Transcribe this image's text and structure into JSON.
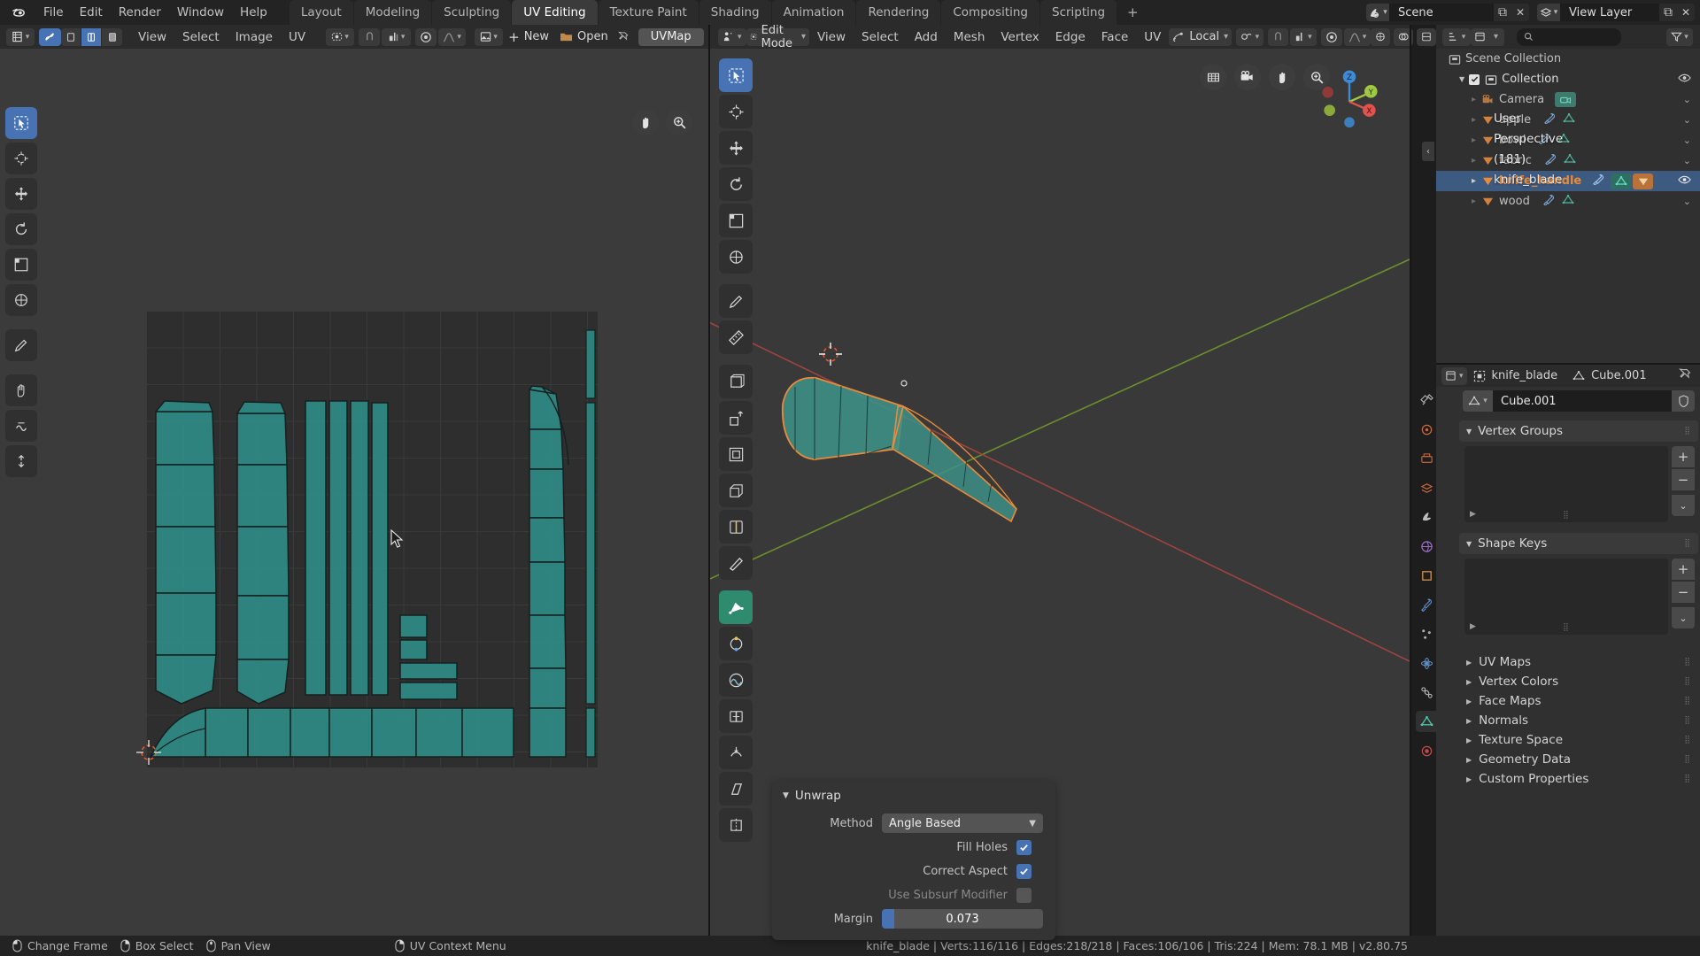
{
  "app": {
    "title": "Blender",
    "version": "v2.80.75"
  },
  "topbar": {
    "menus": [
      "File",
      "Edit",
      "Render",
      "Window",
      "Help"
    ],
    "workspaces": [
      {
        "label": "Layout",
        "active": false
      },
      {
        "label": "Modeling",
        "active": false
      },
      {
        "label": "Sculpting",
        "active": false
      },
      {
        "label": "UV Editing",
        "active": true
      },
      {
        "label": "Texture Paint",
        "active": false
      },
      {
        "label": "Shading",
        "active": false
      },
      {
        "label": "Animation",
        "active": false
      },
      {
        "label": "Rendering",
        "active": false
      },
      {
        "label": "Compositing",
        "active": false
      },
      {
        "label": "Scripting",
        "active": false
      }
    ],
    "add_workspace": "+",
    "scene_name": "Scene",
    "view_layer_name": "View Layer"
  },
  "uv_editor": {
    "menus": [
      "View",
      "Select",
      "Image",
      "UV"
    ],
    "new_button": "New",
    "open_button": "Open",
    "uvmap_label": "UVMap",
    "select_modes": [
      "vertex",
      "edge",
      "face"
    ],
    "active_select_mode": "edge",
    "tools": [
      "tweak-tool",
      "cursor-tool",
      "move-tool",
      "rotate-tool",
      "scale-tool",
      "transform-tool",
      "annotate-tool",
      "measure-tool"
    ],
    "gizmos": [
      "hand-pan-icon",
      "zoom-icon"
    ]
  },
  "viewport_3d": {
    "mode": "Edit Mode",
    "menus": [
      "View",
      "Select",
      "Add",
      "Mesh",
      "Vertex",
      "Edge",
      "Face",
      "UV"
    ],
    "orientation": "Local",
    "overlay_line1": "User Perspective",
    "overlay_line2": "(181) knife_blade",
    "select_modes": [
      "vertex",
      "edge",
      "face"
    ],
    "active_select_mode": "edge",
    "gizmo_icons": [
      "grid-icon",
      "camera-icon",
      "hand-pan-icon",
      "zoom-icon"
    ],
    "axis_labels": [
      "Z",
      "Y",
      "X"
    ],
    "tools": [
      "tweak-tool",
      "cursor-tool",
      "move-tool",
      "rotate-tool",
      "scale-tool",
      "transform-tool",
      "annotate-tool",
      "measure-tool",
      "add-cube-tool",
      "extrude-tool",
      "inset-tool",
      "bevel-tool",
      "loopcut-tool",
      "knife-tool",
      "poly-build-tool",
      "spin-tool",
      "smooth-tool",
      "edge-slide-tool",
      "shrink-fatten-tool",
      "shear-tool",
      "rip-region-tool"
    ]
  },
  "operator_panel": {
    "title": "Unwrap",
    "method_label": "Method",
    "method_value": "Angle Based",
    "fill_holes_label": "Fill Holes",
    "fill_holes": true,
    "correct_aspect_label": "Correct Aspect",
    "correct_aspect": true,
    "use_subsurf_label": "Use Subsurf Modifier",
    "use_subsurf": false,
    "margin_label": "Margin",
    "margin_value": "0.073"
  },
  "outliner": {
    "search_placeholder": "",
    "rows": [
      {
        "label": "Scene Collection",
        "type": "collection",
        "depth": 0,
        "selected": false,
        "eye": false,
        "checkbox": false,
        "expand": false,
        "icons": []
      },
      {
        "label": "Collection",
        "type": "collection",
        "depth": 1,
        "selected": false,
        "eye": true,
        "checkbox": true,
        "expand": true,
        "icons": []
      },
      {
        "label": "Camera",
        "type": "camera",
        "depth": 2,
        "selected": false,
        "eye": false,
        "checkbox": false,
        "expand": false,
        "icons": [
          "camera-data-icon"
        ]
      },
      {
        "label": "apple",
        "type": "mesh",
        "depth": 2,
        "selected": false,
        "eye": false,
        "checkbox": false,
        "expand": false,
        "icons": [
          "modifier-icon",
          "mesh-data-icon"
        ]
      },
      {
        "label": "bowl",
        "type": "mesh",
        "depth": 2,
        "selected": false,
        "eye": false,
        "checkbox": false,
        "expand": false,
        "icons": [
          "modifier-icon",
          "mesh-data-icon"
        ]
      },
      {
        "label": "fabric",
        "type": "mesh",
        "depth": 2,
        "selected": false,
        "eye": false,
        "checkbox": false,
        "expand": false,
        "icons": [
          "modifier-icon",
          "mesh-data-icon"
        ]
      },
      {
        "label": "knife_handle",
        "type": "mesh",
        "depth": 2,
        "selected": true,
        "eye": true,
        "checkbox": false,
        "expand": false,
        "icons": [
          "modifier-icon",
          "mesh-data-icon",
          "object-data-icon"
        ]
      },
      {
        "label": "wood",
        "type": "mesh",
        "depth": 2,
        "selected": false,
        "eye": false,
        "checkbox": false,
        "expand": false,
        "icons": [
          "modifier-icon",
          "mesh-data-icon"
        ]
      }
    ]
  },
  "properties": {
    "breadcrumb_object": "knife_blade",
    "breadcrumb_data": "Cube.001",
    "datablock_name": "Cube.001",
    "open_panels": [
      {
        "label": "Vertex Groups"
      },
      {
        "label": "Shape Keys"
      }
    ],
    "closed_panels": [
      {
        "label": "UV Maps"
      },
      {
        "label": "Vertex Colors"
      },
      {
        "label": "Face Maps"
      },
      {
        "label": "Normals"
      },
      {
        "label": "Texture Space"
      },
      {
        "label": "Geometry Data"
      },
      {
        "label": "Custom Properties"
      }
    ],
    "tabs": [
      "tool-tab",
      "render-tab",
      "output-tab",
      "view-layer-tab",
      "scene-tab",
      "world-tab",
      "object-tab",
      "modifier-tab",
      "particles-tab",
      "physics-tab",
      "constraints-tab",
      "object-data-tab",
      "material-tab"
    ],
    "active_tab": "object-data-tab"
  },
  "statusbar": {
    "keys": [
      {
        "icon": "mouse-left-icon",
        "label": "Change Frame"
      },
      {
        "icon": "mouse-right-icon",
        "label": "Box Select"
      },
      {
        "icon": "mouse-middle-icon",
        "label": "Pan View"
      },
      {
        "icon": "mouse-right-icon",
        "label": "UV Context Menu"
      }
    ],
    "stats": "knife_blade | Verts:116/116 | Edges:218/218 | Faces:106/106 | Tris:224 | Mem: 78.1 MB | v2.80.75"
  },
  "colors": {
    "accent_blue": "#4772b3",
    "uv_fill": "#2f8a84",
    "uv_edge": "#1d1d1d",
    "mesh_selected_orange": "#e98b3a",
    "axis_x": "#e0534e",
    "axis_y": "#a0c942",
    "axis_z": "#3d8bd4"
  }
}
